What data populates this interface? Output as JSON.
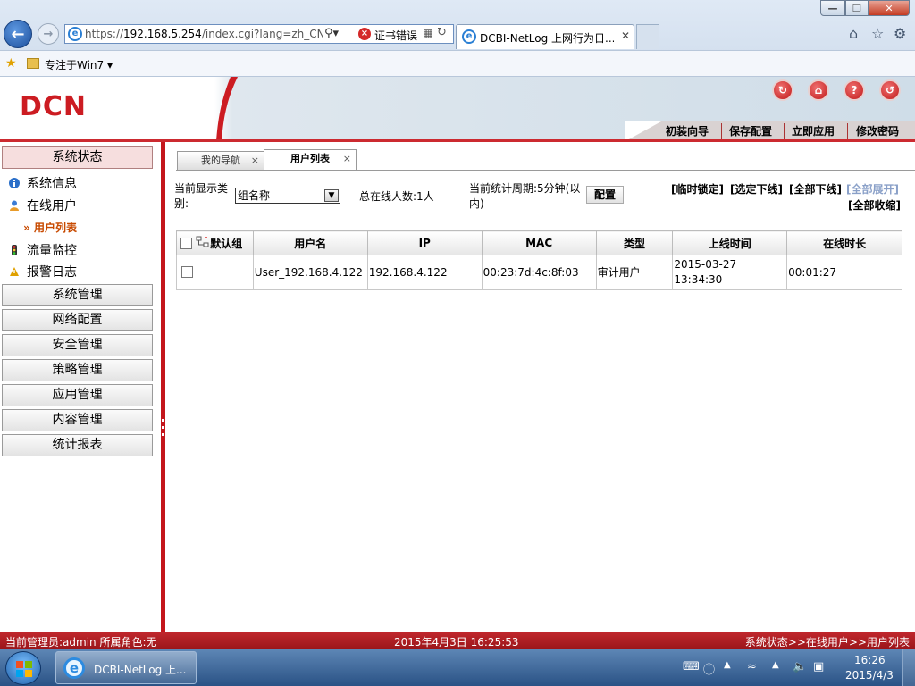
{
  "browser": {
    "url_prefix": "https://",
    "url_host": "192.168.5.254",
    "url_path": "/index.cgi?lang=zh_CN,U",
    "cert_error": "证书错误",
    "tab_title": "DCBI-NetLog 上网行为日...",
    "favorites_item": "专注于Win7 ▾"
  },
  "header": {
    "logo": "DCN",
    "buttons": [
      "初装向导",
      "保存配置",
      "立即应用",
      "修改密码"
    ]
  },
  "sidebar": {
    "status_head": "系统状态",
    "items": [
      "系统信息",
      "在线用户"
    ],
    "sub_item": "用户列表",
    "item_alarm": "报警日志",
    "item_traffic": "流量监控",
    "sections": [
      "系统管理",
      "网络配置",
      "安全管理",
      "策略管理",
      "应用管理",
      "内容管理",
      "统计报表"
    ]
  },
  "main": {
    "tabs": [
      "我的导航",
      "用户列表"
    ],
    "tab_close": "×",
    "display_label": "当前显示类别:",
    "group_select_value": "组名称",
    "total_online": "总在线人数:1人",
    "stat_period": "当前统计周期:5分钟(以内)",
    "config_button": "配置",
    "actions": [
      "[临时锁定]",
      "[选定下线]",
      "[全部下线]",
      "[全部展开]",
      "[全部收缩]"
    ],
    "table": {
      "headers": [
        "默认组",
        "用户名",
        "IP",
        "MAC",
        "类型",
        "上线时间",
        "在线时长"
      ],
      "rows": [
        {
          "username": "User_192.168.4.122",
          "ip": "192.168.4.122",
          "mac": "00:23:7d:4c:8f:03",
          "type": "审计用户",
          "login_time": "2015-03-27 13:34:30",
          "duration": "00:01:27"
        }
      ]
    }
  },
  "status_bar": {
    "admin": "当前管理员:admin  所属角色:无",
    "datetime": "2015年4月3日  16:25:53",
    "breadcrumb": "系统状态>>在线用户>>用户列表"
  },
  "taskbar": {
    "item_label": "DCBI-NetLog 上...",
    "time": "16:26",
    "date": "2015/4/3"
  },
  "colors": {
    "brand_red": "#cc1c22",
    "link_disabled": "#8aa0c8",
    "submenu_orange": "#c84a00"
  }
}
